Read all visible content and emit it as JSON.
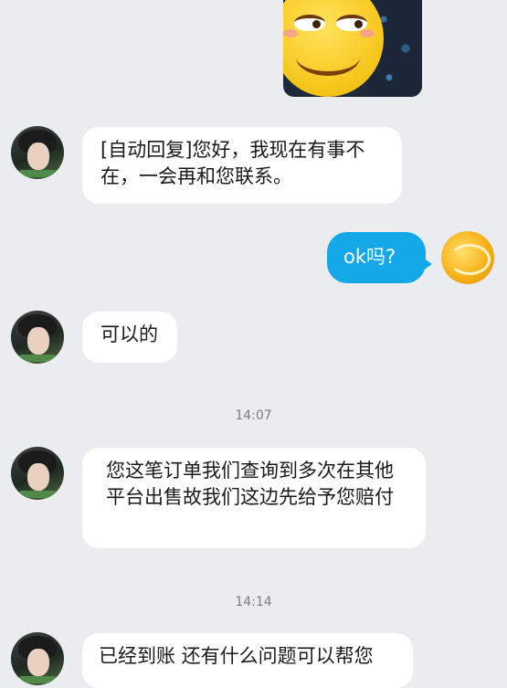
{
  "messages": [
    {
      "text": "[自动回复]您好，我现在有事不在，一会再和您联系。"
    },
    {
      "text": "ok吗?"
    },
    {
      "text": "可以的"
    },
    {
      "text": "您这笔订单我们查询到多次在其他平台出售故我们这边先给予您赔付"
    },
    {
      "text": "已经到账 还有什么问题可以帮您"
    }
  ],
  "timestamps": [
    "14:07",
    "14:14"
  ],
  "colors": {
    "background": "#ebecf0",
    "sent_bubble": "#14a8e8",
    "received_bubble": "#ffffff"
  }
}
